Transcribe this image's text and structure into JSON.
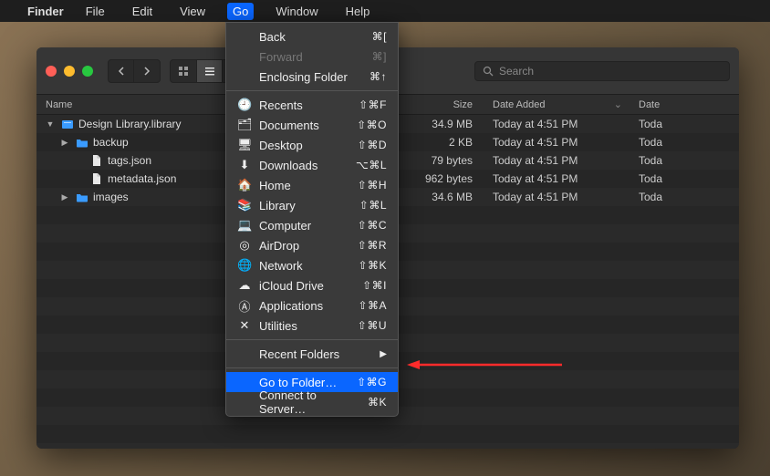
{
  "menubar": {
    "app": "Finder",
    "items": [
      "File",
      "Edit",
      "View",
      "Go",
      "Window",
      "Help"
    ],
    "active_index": 3
  },
  "window": {
    "title": "Design Library.library",
    "search_placeholder": "Search"
  },
  "columns": {
    "name": "Name",
    "size": "Size",
    "date_added": "Date Added",
    "date_modified": "Date"
  },
  "rows": [
    {
      "indent": 0,
      "disclosure": "▼",
      "icon": "library",
      "name": "Design Library.library",
      "size": "34.9 MB",
      "date": "Today at 4:51 PM",
      "date2": "Toda"
    },
    {
      "indent": 1,
      "disclosure": "▶",
      "icon": "folder",
      "name": "backup",
      "size": "2 KB",
      "date": "Today at 4:51 PM",
      "date2": "Toda"
    },
    {
      "indent": 2,
      "disclosure": "",
      "icon": "file",
      "name": "tags.json",
      "size": "79 bytes",
      "date": "Today at 4:51 PM",
      "date2": "Toda"
    },
    {
      "indent": 2,
      "disclosure": "",
      "icon": "file",
      "name": "metadata.json",
      "size": "962 bytes",
      "date": "Today at 4:51 PM",
      "date2": "Toda"
    },
    {
      "indent": 1,
      "disclosure": "▶",
      "icon": "folder",
      "name": "images",
      "size": "34.6 MB",
      "date": "Today at 4:51 PM",
      "date2": "Toda"
    }
  ],
  "go_menu": [
    {
      "type": "item",
      "label": "Back",
      "shortcut": "⌘["
    },
    {
      "type": "item",
      "label": "Forward",
      "shortcut": "⌘]",
      "disabled": true
    },
    {
      "type": "item",
      "label": "Enclosing Folder",
      "shortcut": "⌘↑"
    },
    {
      "type": "sep"
    },
    {
      "type": "item",
      "icon": "clock",
      "label": "Recents",
      "shortcut": "⇧⌘F"
    },
    {
      "type": "item",
      "icon": "doc",
      "label": "Documents",
      "shortcut": "⇧⌘O"
    },
    {
      "type": "item",
      "icon": "desktop",
      "label": "Desktop",
      "shortcut": "⇧⌘D"
    },
    {
      "type": "item",
      "icon": "download",
      "label": "Downloads",
      "shortcut": "⌥⌘L"
    },
    {
      "type": "item",
      "icon": "home",
      "label": "Home",
      "shortcut": "⇧⌘H"
    },
    {
      "type": "item",
      "icon": "library",
      "label": "Library",
      "shortcut": "⇧⌘L"
    },
    {
      "type": "item",
      "icon": "computer",
      "label": "Computer",
      "shortcut": "⇧⌘C"
    },
    {
      "type": "item",
      "icon": "airdrop",
      "label": "AirDrop",
      "shortcut": "⇧⌘R"
    },
    {
      "type": "item",
      "icon": "network",
      "label": "Network",
      "shortcut": "⇧⌘K"
    },
    {
      "type": "item",
      "icon": "cloud",
      "label": "iCloud Drive",
      "shortcut": "⇧⌘I"
    },
    {
      "type": "item",
      "icon": "apps",
      "label": "Applications",
      "shortcut": "⇧⌘A"
    },
    {
      "type": "item",
      "icon": "utilities",
      "label": "Utilities",
      "shortcut": "⇧⌘U"
    },
    {
      "type": "sep"
    },
    {
      "type": "item",
      "label": "Recent Folders",
      "submenu": true
    },
    {
      "type": "sep"
    },
    {
      "type": "item",
      "label": "Go to Folder…",
      "shortcut": "⇧⌘G",
      "highlight": true
    },
    {
      "type": "item",
      "label": "Connect to Server…",
      "shortcut": "⌘K"
    }
  ],
  "icons": {
    "clock": "🕘",
    "doc": "🗂",
    "desktop": "🖥",
    "download": "⬇",
    "home": "🏠",
    "library": "📚",
    "computer": "💻",
    "airdrop": "◎",
    "network": "🌐",
    "cloud": "☁",
    "apps": "Ⓐ",
    "utilities": "✕"
  }
}
